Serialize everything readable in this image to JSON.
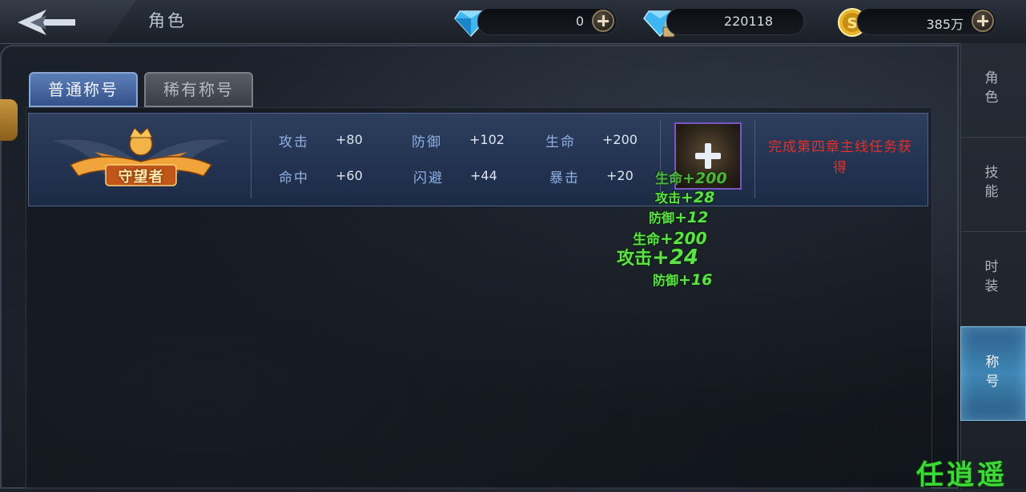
{
  "header": {
    "title": "角色",
    "currencies": [
      {
        "icon": "diamond-icon",
        "value": "0"
      },
      {
        "icon": "locked-diamond-icon",
        "value": "220118"
      },
      {
        "icon": "gold-coin-icon",
        "value": "385万"
      }
    ]
  },
  "tabs": [
    {
      "label": "普通称号",
      "active": true
    },
    {
      "label": "稀有称号",
      "active": false
    }
  ],
  "title_card": {
    "emblem_text": "守望者",
    "stats": [
      {
        "label": "攻击",
        "value": "+80"
      },
      {
        "label": "防御",
        "value": "+102"
      },
      {
        "label": "生命",
        "value": "+200"
      },
      {
        "label": "命中",
        "value": "+60"
      },
      {
        "label": "闪避",
        "value": "+44"
      },
      {
        "label": "暴击",
        "value": "+20"
      }
    ],
    "slot_icon": "add-icon",
    "source": "完成第四章主线任务获得"
  },
  "floating_buffs": [
    {
      "label": "生命",
      "value": "+200"
    },
    {
      "label": "攻击",
      "value": "+28"
    },
    {
      "label": "防御",
      "value": "+12"
    },
    {
      "label": "生命",
      "value": "+200"
    },
    {
      "label": "攻击",
      "value": "+24"
    },
    {
      "label": "防御",
      "value": "+16"
    }
  ],
  "side_nav": [
    {
      "label": "角色",
      "active": false
    },
    {
      "label": "技能",
      "active": false
    },
    {
      "label": "时装",
      "active": false
    },
    {
      "label": "称号",
      "active": true
    }
  ],
  "watermark": "任逍遥",
  "colors": {
    "accent_blue": "#34518a",
    "source_red": "#e0312a",
    "buff_green": "#5ee04a",
    "slot_border": "#7b57c6"
  }
}
